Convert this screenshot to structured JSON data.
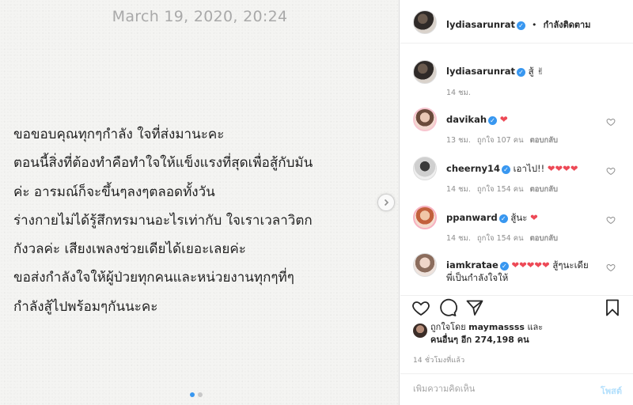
{
  "note": {
    "date": "March 19, 2020, 20:24",
    "lines": [
      "ขอขอบคุณทุกๆกำลัง ใจที่ส่งมานะคะ",
      "ตอนนี้สิ่งที่ต้องทำคือทำใจให้แข็งแรงที่สุดเพื่อสู้กับมัน",
      "ค่ะ อารมณ์ก็จะขึ้นๆลงๆตลอดทั้งวัน",
      "ร่างกายไม่ได้รู้สึกทรมานอะไรเท่ากับ ใจเราเวลาวิตก",
      "กังวลค่ะ เสียงเพลงช่วยเดียได้เยอะเลยค่ะ",
      "ขอส่งกำลังใจให้ผู้ป่วยทุกคนและหน่วยงานทุกๆที่ๆ",
      "กำลังสู้ไปพร้อมๆกันนะคะ"
    ]
  },
  "header": {
    "username": "lydiasarunrat",
    "separator": "•",
    "follow_status": "กำลังติดตาม"
  },
  "comments": [
    {
      "user": "lydiasarunrat",
      "text": "สู้ ✌",
      "time": "14 ชม.",
      "likes": "",
      "reply": ""
    },
    {
      "user": "davikah",
      "text": "❤",
      "time": "13 ชม.",
      "likes": "ถูกใจ 107 คน",
      "reply": "ตอบกลับ"
    },
    {
      "user": "cheerny14",
      "text": "เอาไป!! ❤❤❤❤",
      "time": "14 ชม.",
      "likes": "ถูกใจ 154 คน",
      "reply": "ตอบกลับ"
    },
    {
      "user": "ppanward",
      "text": "สู้นะ ❤",
      "time": "14 ชม.",
      "likes": "ถูกใจ 154 คน",
      "reply": "ตอบกลับ"
    },
    {
      "user": "iamkratae",
      "text": "❤❤❤❤❤ สู้ๆนะเดีย พี่เป็นกำลังใจให้",
      "time": "",
      "likes": "",
      "reply": ""
    }
  ],
  "likes": {
    "prefix": "ถูกใจโดย",
    "user": "maymassss",
    "and": "และ",
    "others": "คนอื่นๆ อีก 274,198 คน"
  },
  "time_ago": "14 ชั่วโมงที่แล้ว",
  "add_comment": {
    "placeholder": "เพิ่มความคิดเห็น",
    "post_label": "โพสต์"
  },
  "colors": {
    "accent": "#3897f0",
    "heart": "#ed4956",
    "post_disabled": "#b2dffc"
  }
}
